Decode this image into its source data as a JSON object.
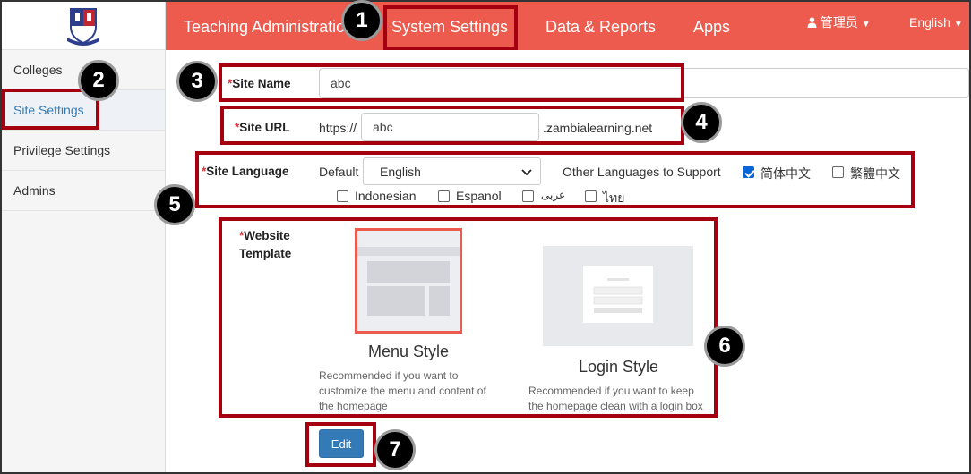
{
  "nav": {
    "tabs": [
      {
        "label": "Teaching Administration"
      },
      {
        "label": "System Settings"
      },
      {
        "label": "Data & Reports"
      },
      {
        "label": "Apps"
      }
    ],
    "user_label": "管理员",
    "language_label": "English"
  },
  "sidebar": {
    "items": [
      {
        "label": "Colleges"
      },
      {
        "label": "Site Settings"
      },
      {
        "label": "Privilege Settings"
      },
      {
        "label": "Admins"
      }
    ]
  },
  "form": {
    "required_mark": "*",
    "site_name": {
      "label": "Site Name",
      "value": "abc"
    },
    "site_url": {
      "label": "Site URL",
      "prefix": "https://",
      "value": "abc",
      "suffix": ".zambialearning.net"
    },
    "site_language": {
      "label": "Site Language",
      "default_label": "Default",
      "default_value": "English",
      "other_label": "Other Languages to Support",
      "languages": [
        {
          "label": "简体中文",
          "checked": true
        },
        {
          "label": "繁體中文",
          "checked": false
        },
        {
          "label": "Indonesian",
          "checked": false
        },
        {
          "label": "Espanol",
          "checked": false
        },
        {
          "label": "عربى",
          "checked": false
        },
        {
          "label": "ไทย",
          "checked": false
        }
      ]
    },
    "website_template": {
      "label_line1": "Website",
      "label_line2": "Template",
      "templates": [
        {
          "title": "Menu Style",
          "desc": "Recommended if you want to customize the menu and content of the homepage",
          "selected": true
        },
        {
          "title": "Login Style",
          "desc": "Recommended if you want to keep the homepage clean with a login box",
          "selected": false
        }
      ]
    },
    "edit_label": "Edit"
  },
  "annotations": [
    "1",
    "2",
    "3",
    "4",
    "5",
    "6",
    "7"
  ],
  "colors": {
    "topbar": "#ec5b4d",
    "highlight": "#a5000f",
    "link": "#337ab7",
    "button": "#337ab7"
  }
}
